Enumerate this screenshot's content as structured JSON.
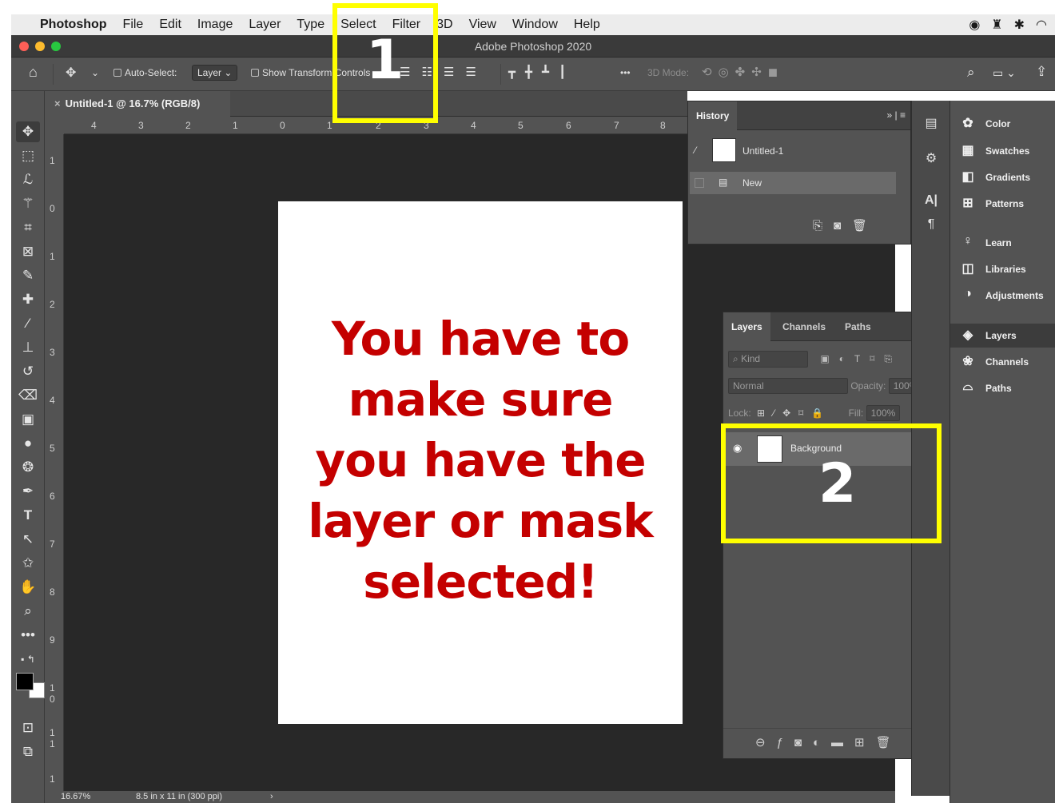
{
  "menubar": {
    "app": "Photoshop",
    "items": [
      "File",
      "Edit",
      "Image",
      "Layer",
      "Type",
      "Select",
      "Filter",
      "3D",
      "View",
      "Window",
      "Help"
    ]
  },
  "window": {
    "title": "Adobe Photoshop 2020"
  },
  "options": {
    "auto_select_label": "Auto-Select:",
    "auto_select_value": "Layer",
    "show_transform": "Show Transform Controls",
    "more": "•••",
    "mode_3d": "3D Mode:"
  },
  "document": {
    "tab": "Untitled-1 @ 16.7% (RGB/8)",
    "canvas_text": "You have to make sure you have the layer or mask selected!"
  },
  "ruler": {
    "h": [
      "4",
      "3",
      "2",
      "1",
      "0",
      "1",
      "2",
      "3",
      "4",
      "5",
      "6",
      "7",
      "8"
    ],
    "v": [
      "1",
      "0",
      "1",
      "2",
      "3",
      "4",
      "5",
      "6",
      "7",
      "8",
      "9",
      "1 0",
      "1 1",
      "1"
    ]
  },
  "status": {
    "zoom": "16.67%",
    "size": "8.5 in x 11 in (300 ppi)"
  },
  "history": {
    "tab": "History",
    "snapshot": "Untitled-1",
    "steps": [
      "New"
    ]
  },
  "layers_panel": {
    "tabs": [
      "Layers",
      "Channels",
      "Paths"
    ],
    "kind": "Kind",
    "blend": "Normal",
    "opacity_label": "Opacity:",
    "opacity_value": "100%",
    "lock_label": "Lock:",
    "fill_label": "Fill:",
    "fill_value": "100%",
    "layers": [
      {
        "name": "Background",
        "locked": true,
        "visible": true
      }
    ]
  },
  "dock": {
    "items": [
      "Color",
      "Swatches",
      "Gradients",
      "Patterns",
      "Learn",
      "Libraries",
      "Adjustments",
      "Layers",
      "Channels",
      "Paths"
    ]
  },
  "callouts": [
    "1",
    "2"
  ],
  "colors": {
    "accent_text": "#c40000",
    "callout": "#ffff00",
    "panel": "#535353"
  }
}
